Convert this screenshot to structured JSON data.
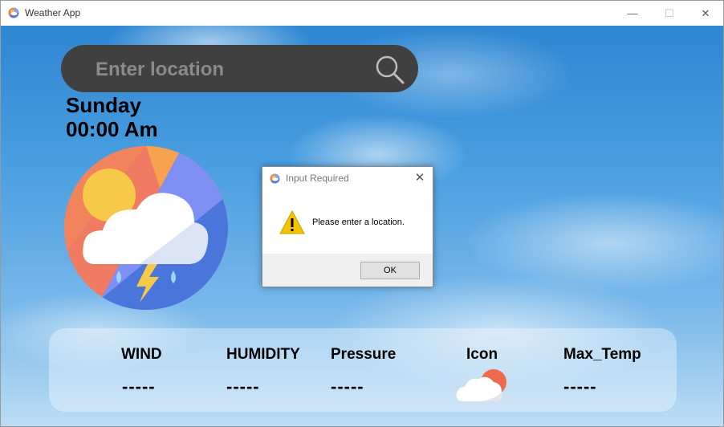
{
  "window": {
    "title": "Weather App",
    "minimize_glyph": "—",
    "maximize_glyph": "☐",
    "close_glyph": "✕"
  },
  "search": {
    "placeholder": "Enter location",
    "icon": "search-icon"
  },
  "datetime": {
    "day": "Sunday",
    "time": "00:00 Am"
  },
  "info_panel": {
    "columns": [
      {
        "label": "WIND",
        "value": "-----"
      },
      {
        "label": "HUMIDITY",
        "value": "-----"
      },
      {
        "label": "Pressure",
        "value": "-----"
      },
      {
        "label": "Icon",
        "icon": "cloud-sun-icon"
      },
      {
        "label": "Max_Temp",
        "value": "-----"
      }
    ]
  },
  "dialog": {
    "title": "Input Required",
    "close_glyph": "✕",
    "message": "Please enter a location.",
    "ok_label": "OK",
    "icon": "warning-icon"
  },
  "colors": {
    "search_bg": "#404040",
    "sky_top": "#2f86d2",
    "warning": "#f5c400"
  }
}
